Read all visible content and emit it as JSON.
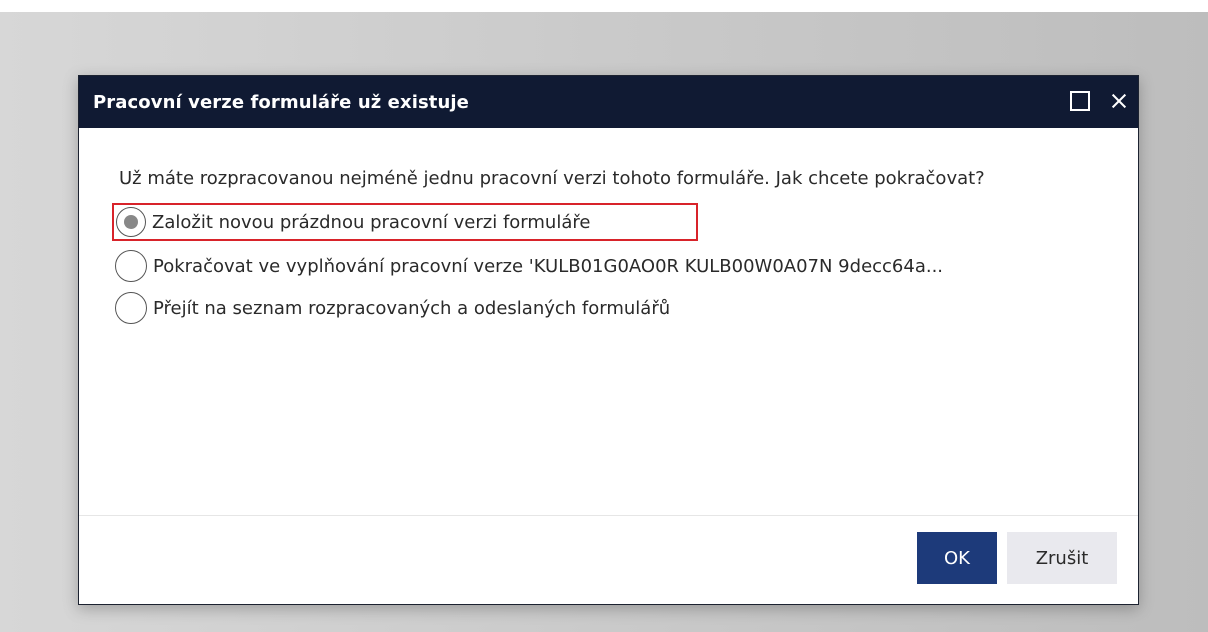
{
  "dialog": {
    "title": "Pracovní verze formuláře už existuje",
    "question": "Už máte rozpracovanou nejméně jednu pracovní verzi tohoto formuláře. Jak chcete pokračovat?",
    "options": [
      {
        "label": "Založit novou prázdnou pracovní verzi formuláře",
        "selected": true
      },
      {
        "label": "Pokračovat ve vyplňování pracovní verze 'KULB01G0AO0R KULB00W0A07N 9decc64a...",
        "selected": false
      },
      {
        "label": "Přejít na seznam rozpracovaných a odeslaných formulářů",
        "selected": false
      }
    ],
    "ok_label": "OK",
    "cancel_label": "Zrušit"
  },
  "icons": {
    "maximize": "maximize-icon",
    "close": "close-icon"
  },
  "colors": {
    "titlebar": "#101a33",
    "primary_button": "#1d3a7a",
    "highlight": "#d8232a",
    "secondary_button": "#e9e9ee"
  }
}
